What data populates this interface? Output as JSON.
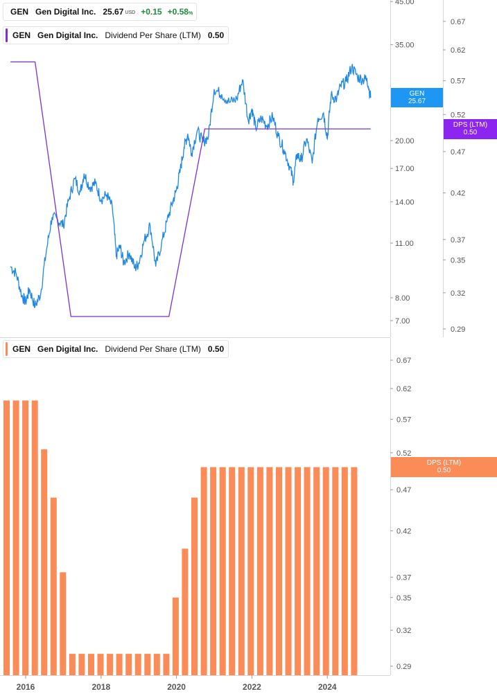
{
  "colors": {
    "price_line": "#1f88e5",
    "dps_line": "#7a2fd6",
    "dps_bar": "#fb8c57",
    "price_tag": "#1e96f3",
    "dps_tag_top": "#8b25ef",
    "dps_tag_bottom": "#fb8c57",
    "positive": "#1f8a3a",
    "axis": "#9a9a9a"
  },
  "legend_top_price": {
    "ticker": "GEN",
    "name": "Gen Digital Inc.",
    "price": "25.67",
    "currency": "USD",
    "change": "+0.15",
    "change_pct": "+0.58",
    "pct_sign": "%"
  },
  "legend_top_dps": {
    "ticker": "GEN",
    "name": "Gen Digital Inc.",
    "metric": "Dividend Per Share (LTM)",
    "value": "0.50"
  },
  "legend_bottom_dps": {
    "ticker": "GEN",
    "name": "Gen Digital Inc.",
    "metric": "Dividend Per Share (LTM)",
    "value": "0.50"
  },
  "price_tag": {
    "ticker": "GEN",
    "value": "25.67"
  },
  "dps_tag_top": {
    "label": "DPS (LTM)",
    "value": "0.50"
  },
  "dps_tag_bottom": {
    "label": "DPS (LTM)",
    "value": "0.50"
  },
  "chart_data": [
    {
      "type": "line",
      "scale": "log",
      "series": [
        {
          "axis": "left",
          "x": [
            2015.6,
            2015.75,
            2015.9,
            2016.0,
            2016.1,
            2016.25,
            2016.4,
            2016.55,
            2016.7,
            2016.85,
            2017.0,
            2017.15,
            2017.3,
            2017.45,
            2017.55,
            2017.7,
            2017.85,
            2018.0,
            2018.15,
            2018.3,
            2018.4,
            2018.5,
            2018.6,
            2018.75,
            2018.9,
            2019.0,
            2019.15,
            2019.3,
            2019.45,
            2019.6,
            2019.75,
            2019.9,
            2020.0,
            2020.1,
            2020.2,
            2020.3,
            2020.4,
            2020.55,
            2020.7,
            2020.85,
            2021.0,
            2021.2,
            2021.4,
            2021.6,
            2021.75,
            2021.9,
            2022.0,
            2022.1,
            2022.25,
            2022.4,
            2022.55,
            2022.7,
            2022.85,
            2023.0,
            2023.1,
            2023.2,
            2023.3,
            2023.45,
            2023.6,
            2023.75,
            2023.9,
            2024.0,
            2024.1,
            2024.25,
            2024.35,
            2024.5,
            2024.65,
            2024.8,
            2024.95,
            2025.05,
            2025.15
          ],
          "y": [
            9.6,
            9.2,
            8.1,
            7.8,
            8.4,
            7.6,
            8.2,
            10.5,
            12.8,
            12.6,
            12.2,
            14.2,
            16.0,
            14.8,
            16.5,
            15.2,
            15.6,
            14.2,
            14.6,
            13.5,
            10.2,
            10.8,
            9.8,
            10.4,
            9.5,
            9.8,
            11.2,
            12.2,
            9.6,
            10.9,
            12.5,
            14.0,
            15.0,
            16.8,
            19.2,
            20.8,
            18.6,
            21.2,
            19.8,
            20.5,
            27.0,
            26.2,
            25.0,
            25.5,
            28.5,
            22.5,
            24.0,
            21.5,
            22.8,
            21.8,
            23.0,
            20.5,
            19.0,
            17.2,
            15.8,
            18.5,
            17.8,
            20.2,
            17.5,
            22.8,
            23.5,
            20.2,
            26.0,
            25.5,
            27.5,
            28.2,
            30.8,
            29.0,
            28.5,
            28.8,
            25.67
          ]
        },
        {
          "axis": "right",
          "x": [
            2015.6,
            2016.25,
            2017.2,
            2019.8,
            2020.75,
            2025.15
          ],
          "y": [
            0.6,
            0.6,
            0.3,
            0.3,
            0.5,
            0.5
          ]
        }
      ],
      "y_left_ticks": [
        "7.00",
        "8.00",
        "11.00",
        "14.00",
        "17.00",
        "20.00",
        "35.00",
        "45.00"
      ],
      "y_right_ticks": [
        "0.29",
        "0.32",
        "0.35",
        "0.37",
        "0.42",
        "0.47",
        "0.52",
        "0.57",
        "0.62",
        "0.67"
      ]
    },
    {
      "type": "bar",
      "scale": "log",
      "series": [
        {
          "values": [
            0.6,
            0.6,
            0.6,
            0.6,
            0.525,
            0.46,
            0.375,
            0.3,
            0.3,
            0.3,
            0.3,
            0.3,
            0.3,
            0.3,
            0.3,
            0.3,
            0.3,
            0.3,
            0.35,
            0.4,
            0.46,
            0.5,
            0.5,
            0.5,
            0.5,
            0.5,
            0.5,
            0.5,
            0.5,
            0.5,
            0.5,
            0.5,
            0.5,
            0.5,
            0.5,
            0.5,
            0.5,
            0.5
          ]
        }
      ],
      "y_ticks": [
        "0.29",
        "0.32",
        "0.35",
        "0.37",
        "0.42",
        "0.47",
        "0.52",
        "0.57",
        "0.62",
        "0.67"
      ],
      "x_ticks": [
        "2016",
        "2018",
        "2020",
        "2022",
        "2024"
      ]
    }
  ]
}
